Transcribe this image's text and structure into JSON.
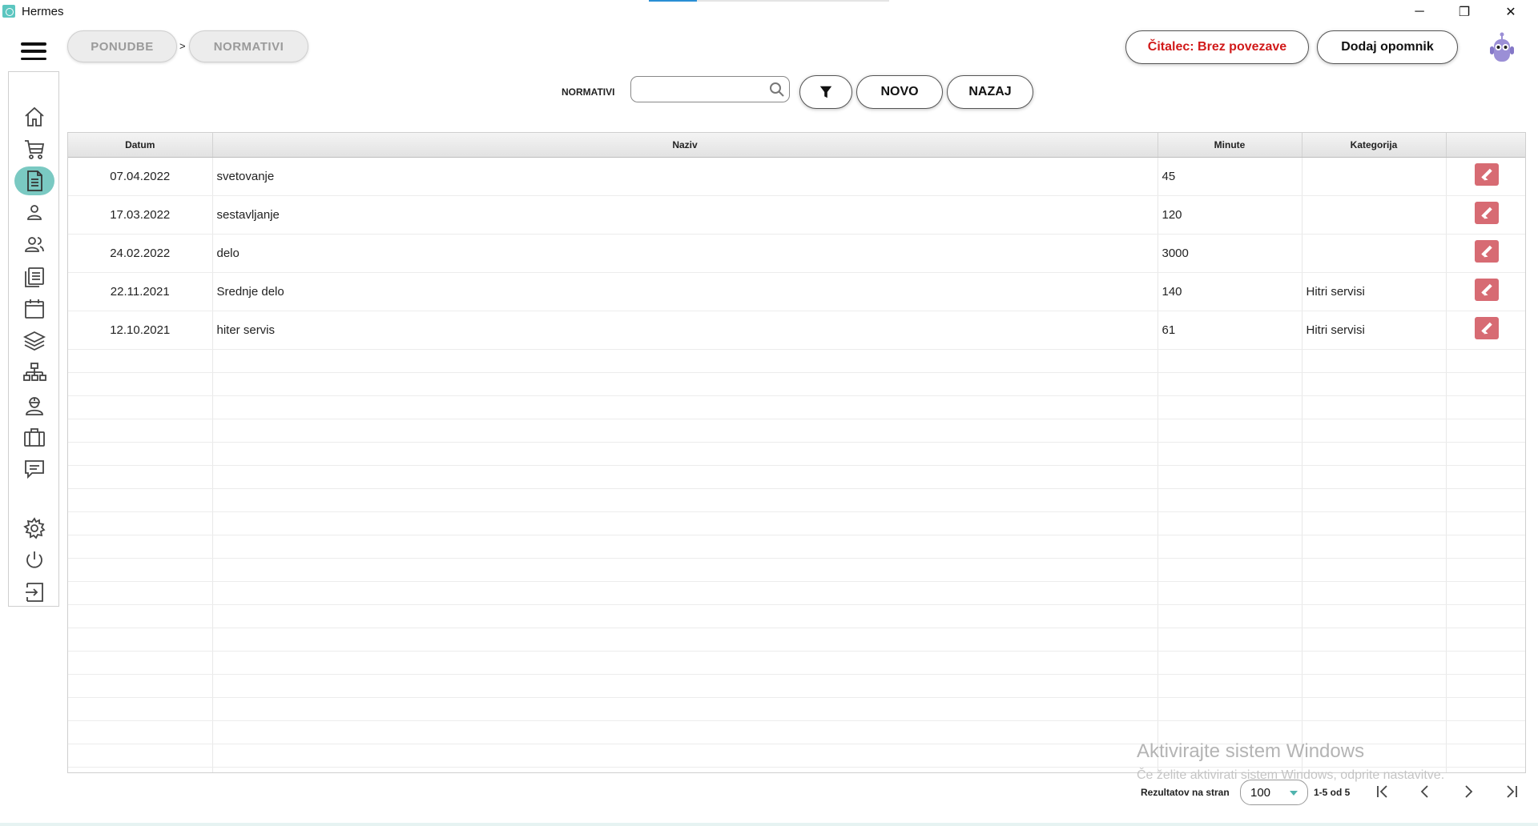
{
  "window": {
    "title": "Hermes",
    "minimize_label": "─",
    "maximize_label": "❐",
    "close_label": "✕"
  },
  "breadcrumb": {
    "items": [
      "PONUDBE",
      "NORMATIVI"
    ],
    "separator": ">"
  },
  "header": {
    "reader_status": "Čitalec: Brez povezave",
    "reminder_button": "Dodaj opomnik"
  },
  "sidebar": {
    "items": [
      {
        "icon": "home-icon"
      },
      {
        "icon": "cart-icon"
      },
      {
        "icon": "document-icon",
        "active": true
      },
      {
        "icon": "user-icon"
      },
      {
        "icon": "users-icon"
      },
      {
        "icon": "list-icon"
      },
      {
        "icon": "calendar-icon"
      },
      {
        "icon": "layers-icon"
      },
      {
        "icon": "network-icon"
      },
      {
        "icon": "worker-icon"
      },
      {
        "icon": "briefcase-icon"
      },
      {
        "icon": "chat-icon"
      },
      {
        "icon": "gear-icon"
      },
      {
        "icon": "power-icon"
      },
      {
        "icon": "exit-icon"
      }
    ],
    "active_color": "#7ac9c2"
  },
  "toolbar": {
    "label": "NORMATIVI",
    "search_value": "",
    "new_button": "NOVO",
    "back_button": "NAZAJ"
  },
  "table": {
    "columns": [
      "Datum",
      "Naziv",
      "Minute",
      "Kategorija",
      ""
    ],
    "rows": [
      {
        "datum": "07.04.2022",
        "naziv": "svetovanje",
        "minute": "45",
        "kategorija": ""
      },
      {
        "datum": "17.03.2022",
        "naziv": "sestavljanje",
        "minute": "120",
        "kategorija": ""
      },
      {
        "datum": "24.02.2022",
        "naziv": "delo",
        "minute": "3000",
        "kategorija": ""
      },
      {
        "datum": "22.11.2021",
        "naziv": "Srednje delo",
        "minute": "140",
        "kategorija": "Hitri servisi"
      },
      {
        "datum": "12.10.2021",
        "naziv": "hiter servis",
        "minute": "61",
        "kategorija": "Hitri servisi"
      }
    ],
    "edit_color": "#d76b73"
  },
  "pager": {
    "label": "Rezultatov na stran",
    "page_size": "100",
    "range": "1-5 od 5"
  },
  "watermark": {
    "title": "Aktivirajte sistem Windows",
    "subtitle": "Če želite aktivirati sistem Windows, odprite nastavitve."
  },
  "colors": {
    "accent": "#7ac9c2",
    "status_red": "#d11a1a"
  }
}
